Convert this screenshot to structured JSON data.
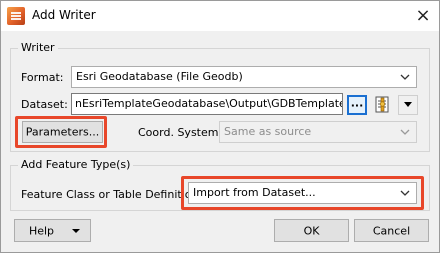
{
  "window": {
    "title": "Add Writer",
    "close_glyph": "×"
  },
  "writer_group": {
    "label": "Writer",
    "format_label": "Format:",
    "format_value": "Esri Geodatabase (File Geodb)",
    "dataset_label": "Dataset:",
    "dataset_value": "nEsriTemplateGeodatabase\\Output\\GDBTemplate.gdb\"",
    "browse_label": "...",
    "parameters_label": "Parameters...",
    "coord_label": "Coord. System:",
    "coord_value": "Same as source"
  },
  "feature_group": {
    "label": "Add Feature Type(s)",
    "definition_label": "Feature Class or Table Definition:",
    "definition_value": "Import from Dataset..."
  },
  "footer": {
    "help_label": "Help",
    "ok_label": "OK",
    "cancel_label": "Cancel"
  },
  "colors": {
    "highlight": "#e8472a",
    "browse_border": "#1a6fd1"
  },
  "icons": [
    "app-icon",
    "close-icon",
    "chevron-down-icon",
    "settings-list-icon",
    "dropdown-triangle-icon"
  ]
}
